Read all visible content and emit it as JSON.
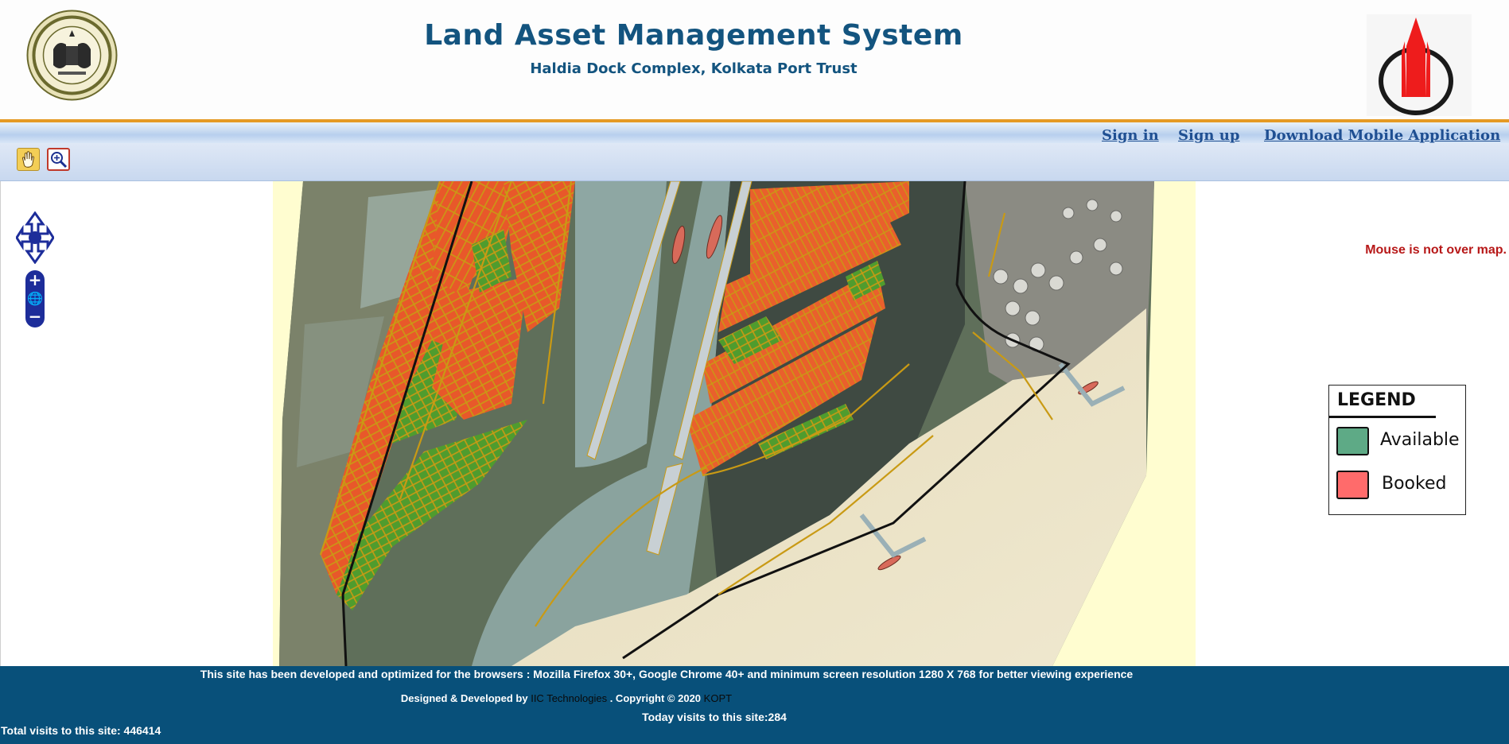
{
  "header": {
    "title": "Land Asset Management System",
    "subtitle": "Haldia Dock Complex, Kolkata Port Trust",
    "seal_icon": "kolkata-port-trust-seal",
    "brand_logo_icon": "red-flame-logo"
  },
  "nav": {
    "sign_in": "Sign in",
    "sign_up": "Sign up",
    "download": "Download Mobile Application"
  },
  "toolbar": {
    "tools": [
      "hand-pan-icon",
      "zoom-box-icon"
    ]
  },
  "map": {
    "status": "Mouse is not over map.",
    "controls": [
      "pan-arrows-icon",
      "zoom-in-icon",
      "world-icon",
      "zoom-out-icon"
    ],
    "zoom_in_glyph": "+",
    "zoom_out_glyph": "−",
    "world_glyph": "🌐"
  },
  "legend": {
    "title": "LEGEND",
    "items": [
      {
        "label": "Available",
        "color": "#5eaa86"
      },
      {
        "label": "Booked",
        "color": "#ff6b6b"
      }
    ]
  },
  "footer": {
    "browser_note": "This site has been developed and optimized for the browsers : Mozilla Firefox 30+, Google Chrome 40+ and minimum screen resolution 1280 X 768 for better viewing experience",
    "designed_prefix": "Designed & Developed by",
    "developer": "IIC Technologies",
    "copyright": ". Copyright © 2020",
    "owner": "KOPT",
    "visits_today": "Today visits to this site:284",
    "visits_total": "Total visits to this site: 446414"
  },
  "colors": {
    "header_text": "#13547f",
    "nav_link": "#1f4f92",
    "accent_rule": "#e59a24",
    "footer_bg": "#08507a",
    "status_text": "#b71818"
  }
}
